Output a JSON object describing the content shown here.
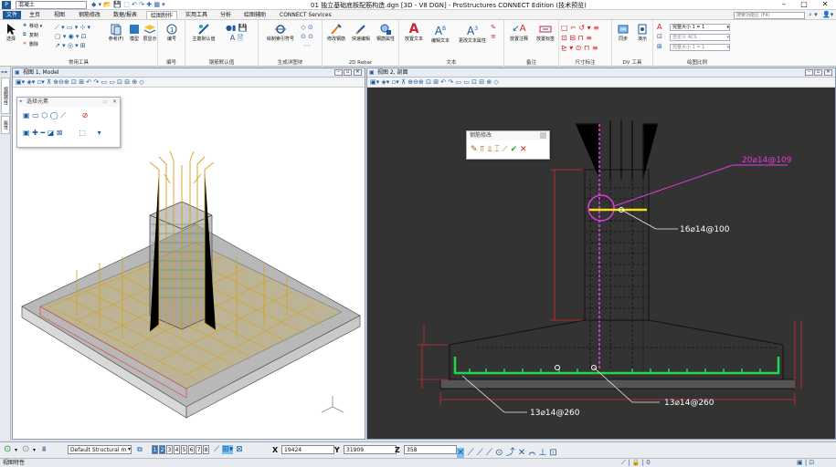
{
  "titlebar": {
    "workset": "混凝土",
    "title": "01 独立基础底板配筋构造.dgn [3D - V8 DGN] - ProStructures CONNECT Edition (技术预览)"
  },
  "tabs": [
    "文件",
    "主页",
    "视图",
    "钢筋修改",
    "数据/报表",
    "绘图制作",
    "实用工具",
    "分析",
    "绘图辅助",
    "CONNECT Services"
  ],
  "search_placeholder": "搜索功能区 (F4)",
  "ribbon": {
    "groups": [
      "常用工具",
      "编号",
      "钢筋默认值",
      "生成详图块",
      "2D Rebar",
      "文本",
      "备注",
      "尺寸标注",
      "DV 工具",
      "绘图比例"
    ],
    "select": "选择",
    "move": "移动",
    "copy": "复制",
    "delete": "删除",
    "refs": "参考(F)",
    "model": "模型",
    "layers": "层显示",
    "number": "编号",
    "rebar_default": "主筋默认值",
    "draw_tag": "绘制索引符号",
    "modify_rebar": "修改钢筋",
    "quick_edit": "快速编辑",
    "rebar_prop": "钢筋属性",
    "place_text": "放置文本",
    "edit_text": "编辑文本",
    "change_text_prop": "更改文本属性",
    "place_note": "放置注释",
    "place_label": "放置标签",
    "sync": "同步",
    "demo": "演示",
    "scale1": "完整大小 1 = 1",
    "scale2": "自定义 ACS",
    "scale3": "完整大小 1 = 1"
  },
  "leftpanel": {
    "tab1": "视图特性",
    "tab2": "属性"
  },
  "view1": {
    "title": "视图 1, Model"
  },
  "view2": {
    "title": "视图 2, 剖面"
  },
  "select_panel": {
    "title": "选择元素"
  },
  "rebar_panel": {
    "title": "钢筋修改"
  },
  "annotations": {
    "a1": "20⌀14@109",
    "a2": "16⌀14@100",
    "a3": "13⌀14@260",
    "a4": "13⌀14@260"
  },
  "bottombar": {
    "level": "Default Structural m",
    "views": [
      "1",
      "2",
      "3",
      "4",
      "5",
      "6",
      "7",
      "8"
    ],
    "x_label": "X",
    "x": "19424",
    "y_label": "Y",
    "y": "31909",
    "z_label": "Z",
    "z": "358"
  },
  "status": {
    "text": "视图特性"
  },
  "colors": {
    "accent": "#1c5a9a",
    "dim": "#d82b2b",
    "magenta": "#e13cdf",
    "green": "#25d64a",
    "yellow": "#f1e21b",
    "rebar_orange": "#d6a11a"
  }
}
